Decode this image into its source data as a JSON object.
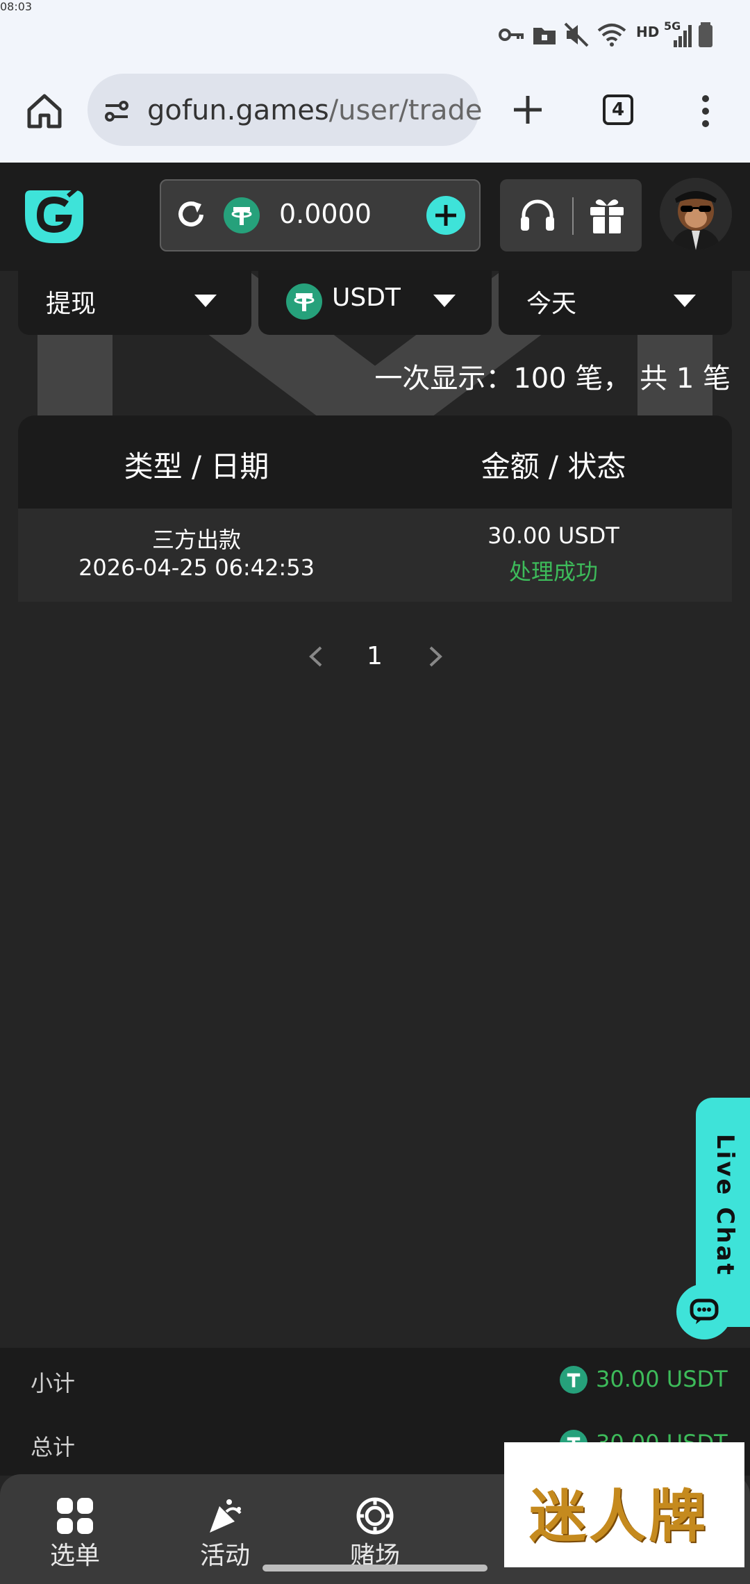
{
  "status_bar": {
    "time": "08:03",
    "network": "HD",
    "signal": "5G"
  },
  "browser": {
    "url_domain": "gofun.games",
    "url_path": "/user/trade",
    "tab_count": "4"
  },
  "header": {
    "balance": "0.0000"
  },
  "filters": {
    "type": "提现",
    "currency": "USDT",
    "period": "今天"
  },
  "summary_text": "一次显示：100 笔， 共 1 笔",
  "table": {
    "headers": [
      "类型 / 日期",
      "金额 / 状态"
    ],
    "rows": [
      {
        "type": "三方出款",
        "date": "2026-04-25 06:42:53",
        "amount": "30.00 USDT",
        "status": "处理成功"
      }
    ]
  },
  "pagination": {
    "current": "1"
  },
  "live_chat": {
    "label": "Live Chat"
  },
  "totals": {
    "subtotal_label": "小计",
    "subtotal_value": "30.00 USDT",
    "total_label": "总计",
    "total_value": "30.00 USDT"
  },
  "bottom_nav": {
    "items": [
      {
        "label": "选单",
        "icon": "grid-icon"
      },
      {
        "label": "活动",
        "icon": "party-popper-icon"
      },
      {
        "label": "赌场",
        "icon": "casino-chip-icon"
      }
    ]
  },
  "promo_overlay": {
    "text": "迷人牌"
  },
  "colors": {
    "accent": "#3ee3d9",
    "success": "#3dbb5a",
    "tether": "#26a17b"
  }
}
